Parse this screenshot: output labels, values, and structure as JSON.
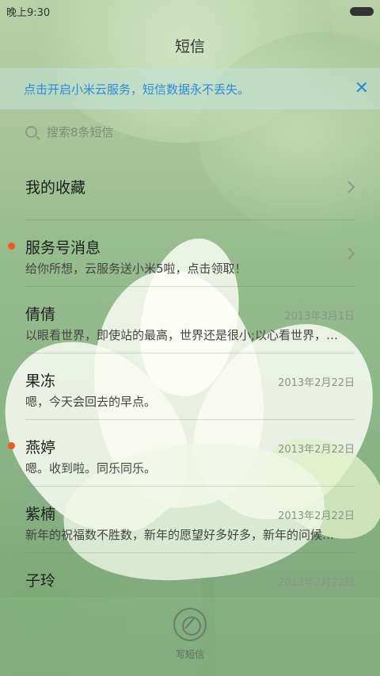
{
  "status_bar": {
    "time": "晚上9:30"
  },
  "header": {
    "title": "短信"
  },
  "banner": {
    "text": "点击开启小米云服务，短信数据永不丢失。",
    "close_icon": "close-icon",
    "accent": "#2e8ad8"
  },
  "search": {
    "placeholder": "搜索8条短信"
  },
  "conversations": [
    {
      "name": "我的收藏",
      "preview": "",
      "date": "",
      "unread": false,
      "chevron": true
    },
    {
      "name": "服务号消息",
      "preview": "给你所想，云服务送小米5啦，点击领取！",
      "date": "",
      "unread": true,
      "chevron": true
    },
    {
      "name": "倩倩",
      "preview": "以眼看世界，即使站的最高，世界还是很小;以心看世界，…",
      "date": "2013年3月1日",
      "unread": false
    },
    {
      "name": "果冻",
      "preview": "嗯，今天会回去的早点。",
      "date": "2013年2月22日",
      "unread": false
    },
    {
      "name": "燕婷",
      "preview": "嗯。收到啦。同乐同乐。",
      "date": "2013年2月22日",
      "unread": true
    },
    {
      "name": "紫楠",
      "preview": "新年的祝福数不胜数，新年的愿望好多好多，新年的问候…",
      "date": "2013年2月22日",
      "unread": false
    },
    {
      "name": "子玲",
      "preview": "",
      "date": "2013年2月22日",
      "unread": false
    }
  ],
  "compose": {
    "label": "写短信"
  },
  "colors": {
    "unread_dot": "#f05a1c"
  }
}
